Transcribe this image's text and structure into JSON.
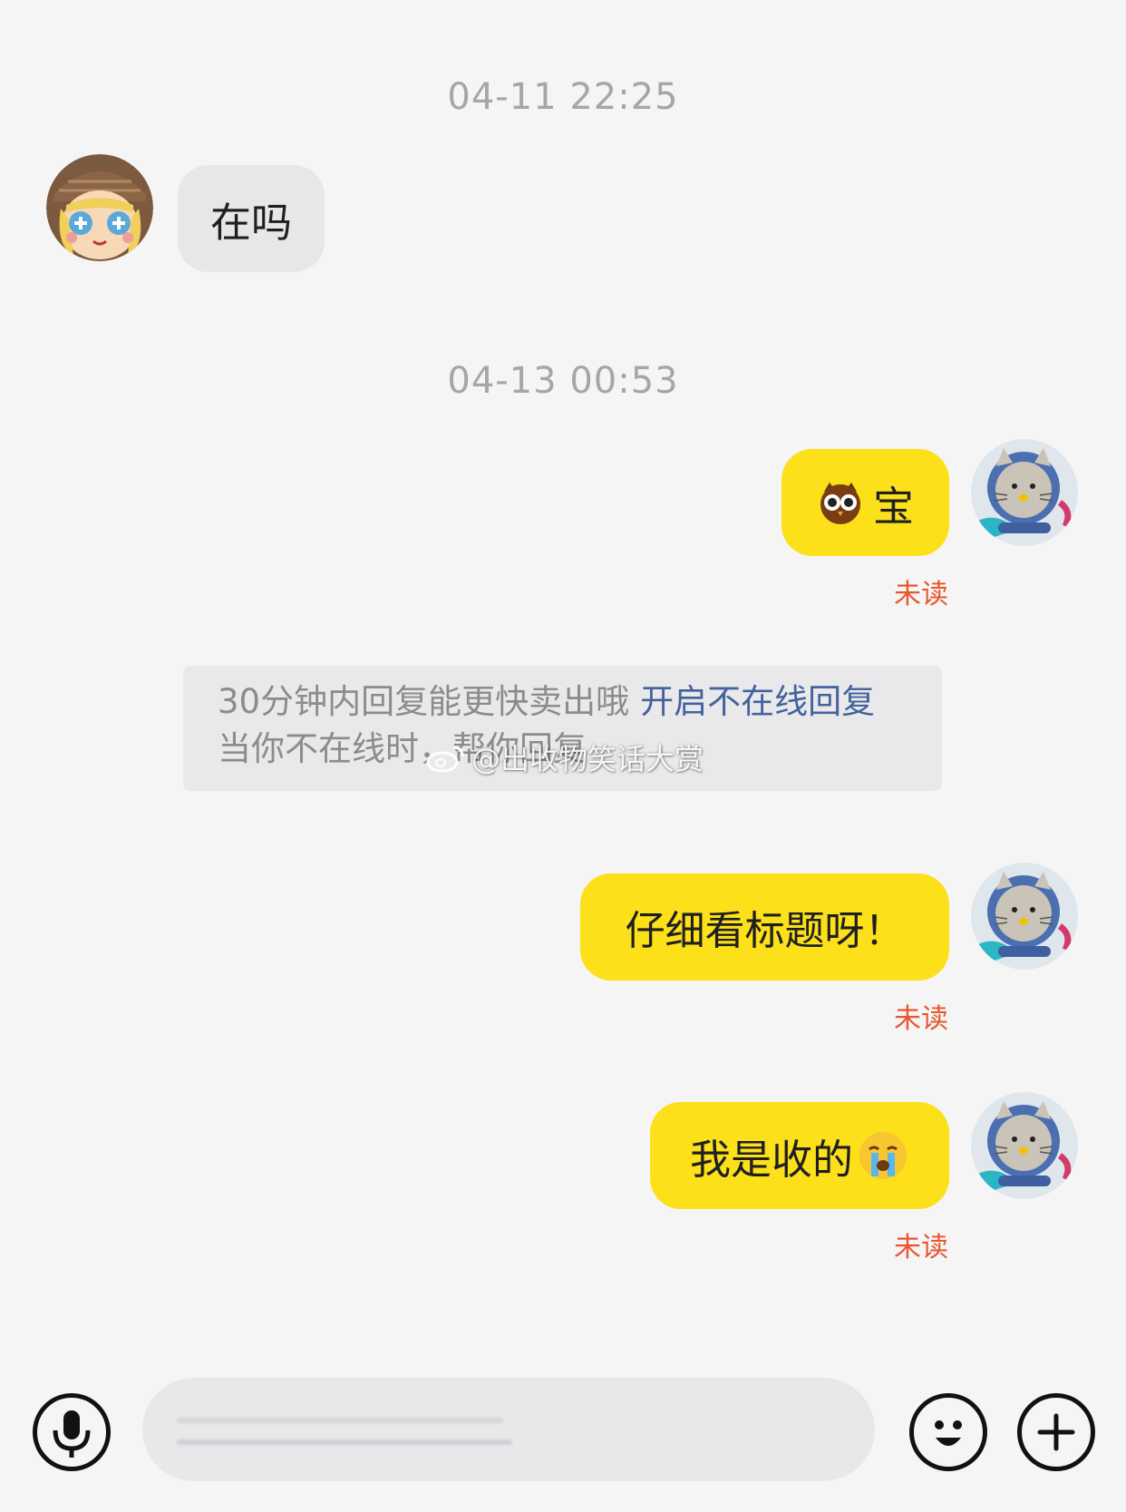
{
  "timestamps": [
    "04-11 22:25",
    "04-13 00:53"
  ],
  "messages": {
    "m1": {
      "text": "在吗"
    },
    "m2": {
      "text": "宝",
      "status": "未读",
      "emoji": "owl-emoji"
    },
    "m3": {
      "text": "仔细看标题呀！",
      "status": "未读"
    },
    "m4": {
      "text": "我是收的",
      "status": "未读",
      "emoji": "crying-face-emoji"
    }
  },
  "system_tip": {
    "line1": "30分钟内回复能更快卖出哦",
    "link": "开启不在线回复",
    "line2": "当你不在线时，帮你回复"
  },
  "watermark": "@出收物笑话大赏",
  "input_bar": {
    "voice_icon": "microphone-icon",
    "emoji_icon": "smiley-icon",
    "add_icon": "plus-icon"
  },
  "colors": {
    "outgoing_bubble": "#fbe01a",
    "incoming_bubble": "#e7e7e9",
    "unread": "#e8572f",
    "link": "#44639c",
    "background": "#f5f5f5"
  }
}
